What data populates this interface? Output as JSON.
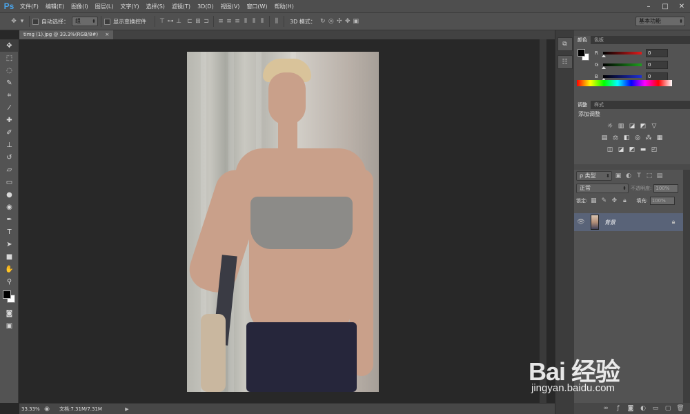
{
  "app": {
    "logo": "Ps"
  },
  "menu": [
    "文件(F)",
    "编辑(E)",
    "图像(I)",
    "图层(L)",
    "文字(Y)",
    "选择(S)",
    "滤镜(T)",
    "3D(D)",
    "视图(V)",
    "窗口(W)",
    "帮助(H)"
  ],
  "window_controls": [
    "–",
    "□",
    "✕"
  ],
  "options": {
    "auto_select_label": "自动选择：",
    "auto_select_value": "组",
    "show_transform_label": "显示变换控件",
    "mode_3d_label": "3D 模式：",
    "workspace": "基本功能"
  },
  "document": {
    "tab_title": "timg (1).jpg @ 33.3%(RGB/8#)",
    "tab_close": "×"
  },
  "status": {
    "zoom": "33.33%",
    "doc_size": "文档:7.31M/7.31M"
  },
  "color_panel": {
    "tabs": [
      "颜色",
      "色板"
    ],
    "channels": [
      {
        "label": "R",
        "value": "0",
        "color": "#e11b1b"
      },
      {
        "label": "G",
        "value": "0",
        "color": "#1ea01e"
      },
      {
        "label": "B",
        "value": "0",
        "color": "#1e2fd8"
      }
    ]
  },
  "adjust_panel": {
    "tabs": [
      "调整",
      "样式"
    ],
    "title": "添加调整"
  },
  "layers_panel": {
    "tabs": [
      "图层",
      "通道",
      "路径"
    ],
    "kind_filter": "ρ 类型",
    "blend_mode": "正常",
    "opacity_label": "不透明度:",
    "opacity_value": "100%",
    "lock_label": "锁定:",
    "fill_label": "填充:",
    "fill_value": "100%",
    "layer_name": "背景"
  },
  "watermark": {
    "text": "Bai 经验",
    "sub": "jingyan.baidu.com"
  }
}
